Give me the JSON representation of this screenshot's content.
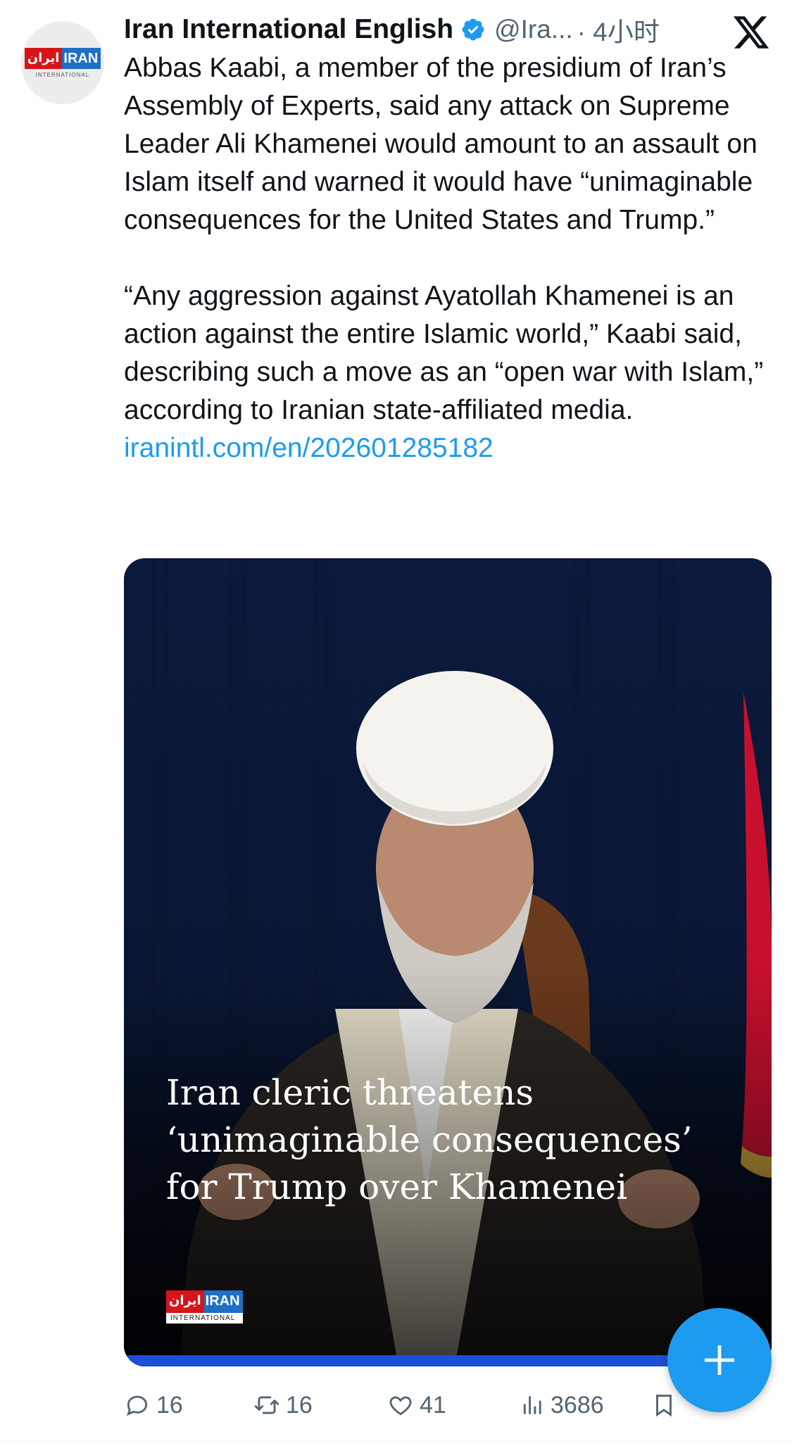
{
  "author": {
    "name": "Iran International English",
    "handle": "@Ira...",
    "time": "· 4小时",
    "avatar_logo": {
      "farsi": "ایران",
      "latin": "IRAN",
      "sub": "INTERNATIONAL"
    }
  },
  "tweet": {
    "paragraph1": "Abbas Kaabi, a member of the presidium of Iran’s Assembly of Experts, said any attack on Supreme Leader Ali Khamenei would amount to an assault on Islam itself and warned it would have “unimaginable consequences for the United States and Trump.”",
    "paragraph2": "“Any aggression against Ayatollah Khamenei is an action against the entire Islamic world,” Kaabi said, describing such a move as an “open war with Islam,” according to Iranian state-affiliated media.",
    "link": "iranintl.com/en/202601285182"
  },
  "media": {
    "headline_lines": [
      "Iran cleric threatens",
      "‘unimaginable consequences’",
      "for Trump over Khamenei"
    ],
    "logo": {
      "farsi": "ایران",
      "latin": "IRAN",
      "sub": "INTERNATIONAL"
    }
  },
  "actions": {
    "replies": "16",
    "reposts": "16",
    "likes": "41",
    "views": "3686"
  },
  "icons": {
    "verified": "verified-badge-icon",
    "platform": "x-logo-icon",
    "compose": "plus-icon",
    "reply": "reply-bubble-icon",
    "repost": "repost-icon",
    "like": "heart-icon",
    "views": "views-bar-chart-icon",
    "bookmark": "bookmark-icon"
  },
  "colors": {
    "link": "#1d9bf0",
    "verified": "#1d9bf0",
    "fab": "#1d9bf0",
    "secondary_text": "#536471",
    "card_bar": "#1d4ed8"
  }
}
